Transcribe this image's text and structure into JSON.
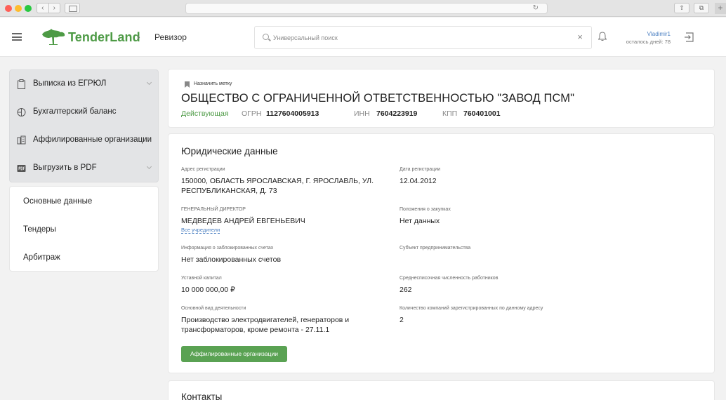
{
  "header": {
    "logo_text": "TenderLand",
    "breadcrumb_sep": "›",
    "breadcrumb": "Ревизор",
    "search_placeholder": "Универсальный поиск",
    "user_name": "Vladimir1",
    "user_days": "осталось дней: 78"
  },
  "sidebar": {
    "tools": [
      {
        "label": "Выписка из ЕГРЮЛ",
        "icon": "clipboard-icon",
        "has_chevron": true
      },
      {
        "label": "Бухгалтерский баланс",
        "icon": "balance-icon",
        "has_chevron": false
      },
      {
        "label": "Аффилированные организации",
        "icon": "org-structure-icon",
        "has_chevron": false
      },
      {
        "label": "Выгрузить в PDF",
        "icon": "pdf-icon",
        "has_chevron": true
      }
    ],
    "nav": [
      "Основные данные",
      "Тендеры",
      "Арбитраж"
    ]
  },
  "company": {
    "tag_label": "Назначить метку",
    "name": "ОБЩЕСТВО С ОГРАНИЧЕННОЙ ОТВЕТСТВЕННОСТЬЮ \"ЗАВОД ПСМ\"",
    "status": "Действующая",
    "ogrn_label": "ОГРН",
    "ogrn": "1127604005913",
    "inn_label": "ИНН",
    "inn": "7604223919",
    "kpp_label": "КПП",
    "kpp": "760401001"
  },
  "legal": {
    "title": "Юридические данные",
    "address_label": "Адрес регистрации",
    "address_line1": "150000, ОБЛАСТЬ ЯРОСЛАВСКАЯ, Г. ЯРОСЛАВЛЬ, УЛ.",
    "address_line2": "РЕСПУБЛИКАНСКАЯ, Д. 73",
    "reg_date_label": "Дата регистрации",
    "reg_date": "12.04.2012",
    "director_label": "ГЕНЕРАЛЬНЫЙ ДИРЕКТОР",
    "director": "МЕДВЕДЕВ АНДРЕЙ ЕВГЕНЬЕВИЧ",
    "founders_link": "Все учредители",
    "procurement_label": "Положения о закупках",
    "procurement": "Нет данных",
    "blocked_label": "Информация о заблокированных счетах",
    "blocked": "Нет заблокированных счетов",
    "entrepreneur_label": "Субъект предпринимательства",
    "capital_label": "Уставной капитал",
    "capital": "10 000 000,00 ₽",
    "employees_label": "Среднесписочная численность работников",
    "employees": "262",
    "activity_label": "Основной вид деятельности",
    "activity_line1": "Производство электродвигателей, генераторов и",
    "activity_line2": "трансформаторов, кроме ремонта - 27.11.1",
    "companies_label": "Количество компаний зарегистрированных по данному адресу",
    "companies": "2",
    "affiliated_button": "Аффилированные организации"
  },
  "contacts": {
    "title": "Контакты"
  },
  "colors": {
    "brand_green": "#4d9a45",
    "button_green": "#5aa253",
    "link_blue": "#4a7fc1"
  }
}
